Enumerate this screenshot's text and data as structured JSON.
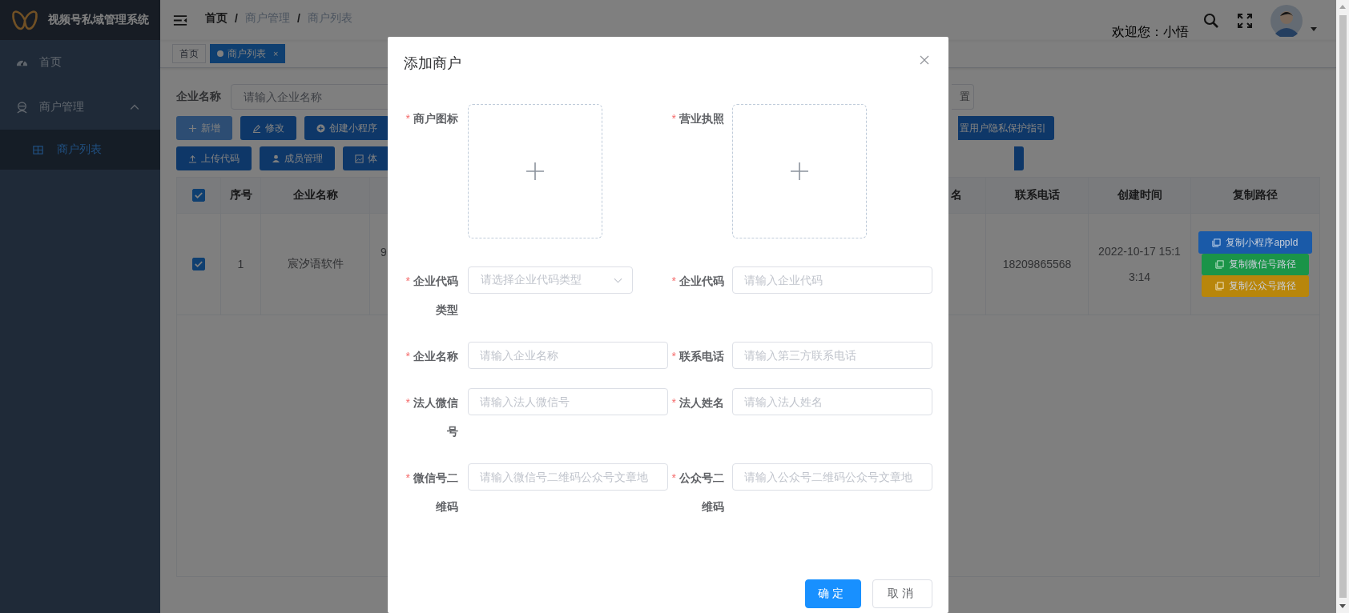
{
  "sidebar": {
    "title": "视频号私域管理系统",
    "items": [
      {
        "label": "首页",
        "selected": false
      },
      {
        "label": "商户管理",
        "selected": false,
        "expanded": true,
        "children": [
          {
            "label": "商户列表",
            "selected": true
          }
        ]
      }
    ]
  },
  "header": {
    "breadcrumb": [
      "首页",
      "商户管理",
      "商户列表"
    ],
    "separator": "/",
    "welcome": "欢迎您：小悟"
  },
  "tags": [
    {
      "label": "首页",
      "selected": false
    },
    {
      "label": "商户列表",
      "selected": true,
      "close": "×"
    }
  ],
  "search": {
    "label": "企业名称",
    "placeholder": "请输入企业名称",
    "button_2": "置"
  },
  "toolbar": {
    "rows": [
      [
        "新增",
        "修改",
        "创建小程序"
      ],
      [
        "上传代码",
        "成员管理",
        "体"
      ]
    ],
    "right": [
      "置用户隐私保护指引"
    ]
  },
  "table": {
    "all_selected": true,
    "columns_left": [
      "序号",
      "企业名称"
    ],
    "columns_right": [
      "名",
      "联系电话",
      "创建时间",
      "复制路径"
    ],
    "rows": [
      {
        "selected": true,
        "index": "1",
        "name": "宸汐语软件",
        "column_4": "9",
        "phone": "18209865568",
        "created": "2022-10-17 15:13:14",
        "copy_buttons": [
          {
            "label": "复制小程序appId",
            "color": "#1a5aa8"
          },
          {
            "label": "复制微信号路径",
            "color": "#1a9448"
          },
          {
            "label": "复制公众号路径",
            "color": "#b8860b"
          }
        ]
      }
    ]
  },
  "modal": {
    "title": "添加商户",
    "fields": [
      {
        "kind": "upload",
        "mark": "*",
        "label": "商户图标"
      },
      {
        "kind": "upload",
        "mark": "*",
        "label": "营业执照"
      },
      {
        "kind": "select",
        "mark": "*",
        "label": "企业代码类型",
        "placeholder": "请选择企业代码类型"
      },
      {
        "kind": "input",
        "mark": "*",
        "label": "企业代码",
        "placeholder": "请输入企业代码"
      },
      {
        "kind": "input",
        "mark": "*",
        "label": "企业名称",
        "placeholder": "请输入企业名称"
      },
      {
        "kind": "input",
        "mark": "*",
        "label": "联系电话",
        "placeholder": "请输入第三方联系电话"
      },
      {
        "kind": "input",
        "mark": "*",
        "label": "法人微信号",
        "placeholder": "请输入法人微信号"
      },
      {
        "kind": "input",
        "mark": "*",
        "label": "法人姓名",
        "placeholder": "请输入法人姓名"
      },
      {
        "kind": "input",
        "mark": "*",
        "label": "微信号二维码",
        "placeholder": "请输入微信号二维码公众号文章地"
      },
      {
        "kind": "input",
        "mark": "*",
        "label": "公众号二维码",
        "placeholder": "请输入公众号二维码公众号文章地"
      }
    ],
    "buttons": [
      {
        "label": "确定",
        "kind": "primary"
      },
      {
        "label": "取消",
        "kind": "default"
      }
    ]
  }
}
